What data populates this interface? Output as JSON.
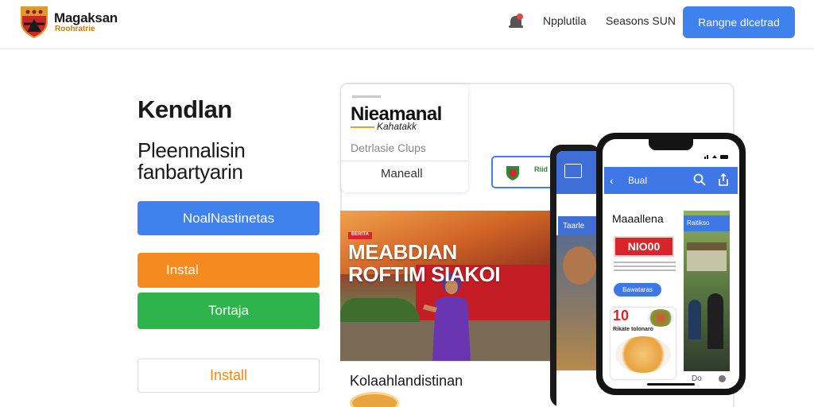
{
  "header": {
    "brand_name": "Magaksan",
    "brand_sub": "Roohratrie",
    "nav": [
      "Npplutila",
      "Seasons SUN"
    ],
    "cta": "Rangne dlcetrad"
  },
  "hero": {
    "title": "Kendlan",
    "subtitle": "Pleennalisin fanbartyarin",
    "buttons": {
      "primary": "NoalNastinetas",
      "orange": "Instal",
      "green": "Tortaja",
      "outline": "Install"
    }
  },
  "card": {
    "title": "Nieamanal",
    "subtitle": "Kahatakk",
    "description": "Detrlasie Clups",
    "action": "Maneall"
  },
  "chip": {
    "label": "Riid"
  },
  "photo": {
    "tag": "BERITA",
    "headline_line1": "MEABDIAN",
    "headline_line2": "ROFTIM SIAKOI",
    "caption": "Kolaahlandistinan"
  },
  "phone_back": {
    "tab": "Taarle"
  },
  "phone_front": {
    "bar_title": "Bual",
    "title": "Maaallena",
    "badge": "NIO00",
    "pill": "Bawataras",
    "food_number": "10",
    "food_sub": "Rikate tolonaro",
    "side_tag": "Raitikso",
    "dots_label": "Do"
  },
  "colors": {
    "accent_blue": "#3f82ee",
    "orange": "#f58a1f",
    "green": "#2fb44b",
    "red": "#d7262b"
  },
  "icons": {
    "logo": "shield-crest-icon",
    "bell": "bell-notification-icon",
    "search": "search-icon",
    "share": "share-icon",
    "back": "chevron-left-icon",
    "image": "image-icon"
  }
}
